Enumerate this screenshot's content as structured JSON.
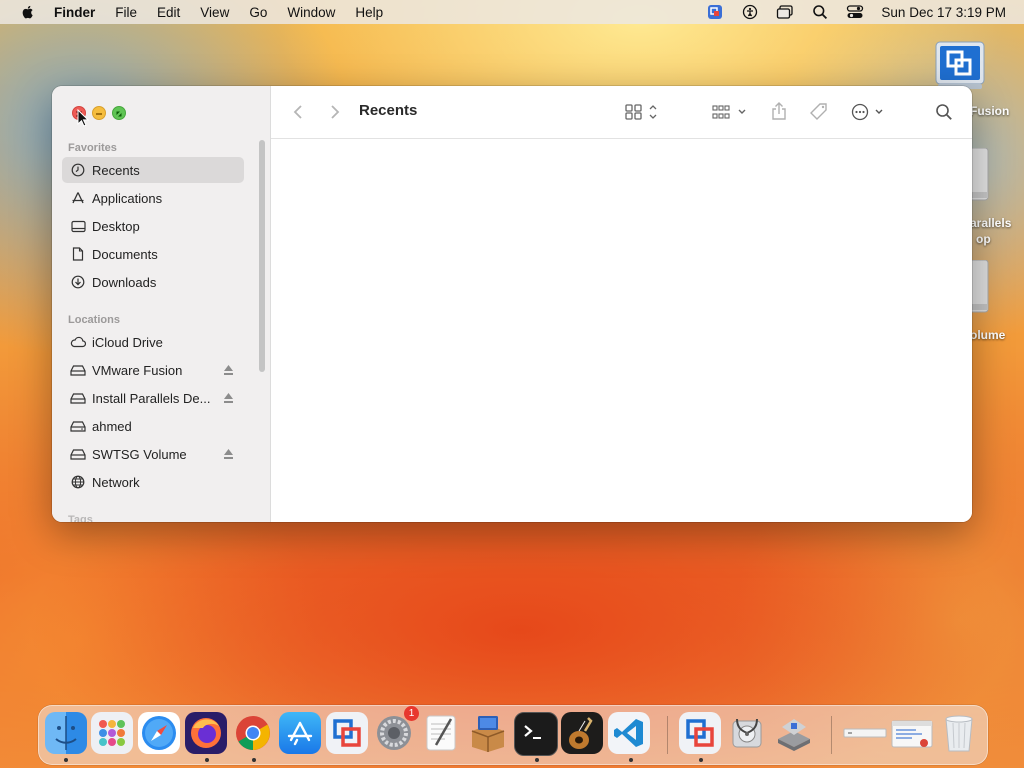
{
  "menubar": {
    "app_name": "Finder",
    "items": [
      "File",
      "Edit",
      "View",
      "Go",
      "Window",
      "Help"
    ],
    "clock": "Sun Dec 17  3:19 PM"
  },
  "desktop": {
    "icons": [
      {
        "label": "Fusion"
      },
      {
        "label": "arallels",
        "label2": "op"
      },
      {
        "label": "olume"
      }
    ]
  },
  "finder": {
    "title": "Recents",
    "sidebar": {
      "favorites_heading": "Favorites",
      "favorites": [
        {
          "label": "Recents",
          "icon": "clock-icon",
          "selected": true
        },
        {
          "label": "Applications",
          "icon": "applications-icon"
        },
        {
          "label": "Desktop",
          "icon": "desktop-icon"
        },
        {
          "label": "Documents",
          "icon": "document-icon"
        },
        {
          "label": "Downloads",
          "icon": "download-icon"
        }
      ],
      "locations_heading": "Locations",
      "locations": [
        {
          "label": "iCloud Drive",
          "icon": "cloud-icon"
        },
        {
          "label": "VMware Fusion",
          "icon": "disk-icon",
          "eject": true
        },
        {
          "label": "Install Parallels De...",
          "icon": "disk-icon",
          "eject": true
        },
        {
          "label": "ahmed",
          "icon": "internal-disk-icon"
        },
        {
          "label": "SWTSG Volume",
          "icon": "disk-icon",
          "eject": true
        },
        {
          "label": "Network",
          "icon": "globe-icon"
        }
      ],
      "tags_heading": "Tags"
    }
  },
  "dock": {
    "apps": [
      {
        "name": "finder-icon",
        "running": true
      },
      {
        "name": "launchpad-icon",
        "running": false
      },
      {
        "name": "safari-icon",
        "running": false
      },
      {
        "name": "firefox-icon",
        "running": true
      },
      {
        "name": "chrome-icon",
        "running": true
      },
      {
        "name": "app-store-icon",
        "running": false
      },
      {
        "name": "vmware-fusion-icon",
        "running": false
      },
      {
        "name": "system-settings-icon",
        "running": false,
        "badge": "1"
      },
      {
        "name": "textedit-icon",
        "running": false
      },
      {
        "name": "installer-icon",
        "running": false
      },
      {
        "name": "terminal-icon",
        "running": true
      },
      {
        "name": "instruments-icon",
        "running": false
      },
      {
        "name": "vscode-icon",
        "running": true
      },
      {
        "name": "vmware-fusion-icon",
        "running": true
      },
      {
        "name": "disk-utility-icon",
        "running": false
      },
      {
        "name": "boot-camp-icon",
        "running": false
      },
      {
        "name": "recent-document-icon",
        "running": false
      },
      {
        "name": "recent-window-icon",
        "running": false
      },
      {
        "name": "trash-icon",
        "running": false
      }
    ]
  }
}
